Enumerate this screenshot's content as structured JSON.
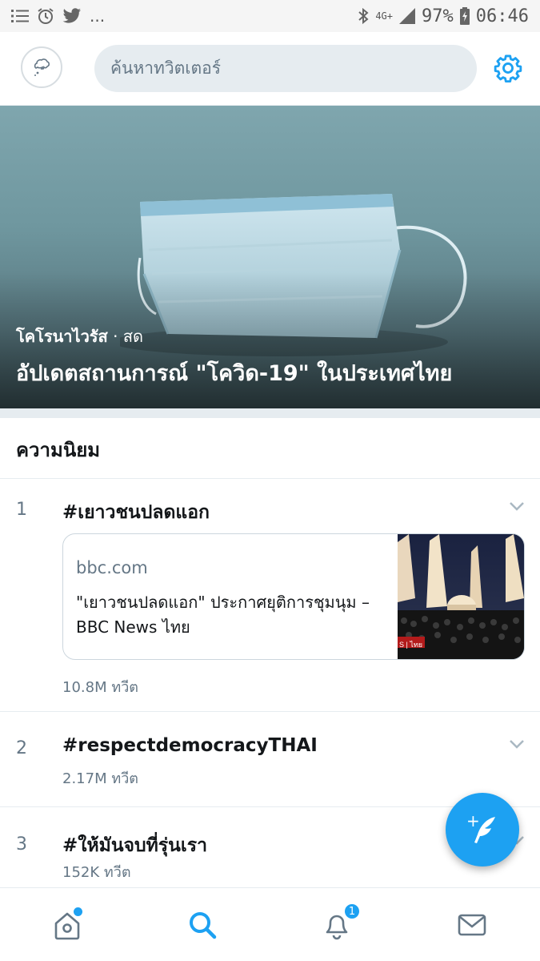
{
  "status_bar": {
    "time": "06:46",
    "battery": "97%",
    "network": "4G+",
    "more": "...",
    "icons": [
      "list-icon",
      "alarm-icon",
      "twitter-icon",
      "bluetooth-icon",
      "signal-icon",
      "battery-charging-icon"
    ]
  },
  "header": {
    "search_placeholder": "ค้นหาทวิตเตอร์",
    "avatar_icon": "avatar-icon",
    "settings_icon": "gear-icon"
  },
  "hero": {
    "kicker": "โคโรนาไวรัส",
    "separator": " · ",
    "live_label": "สด",
    "title": "อัปเดตสถานการณ์ \"โควิด-19\" ในประเทศไทย"
  },
  "section": {
    "title": "ความนิยม"
  },
  "trends": [
    {
      "rank": "1",
      "tag": "#เยาวชนปลดแอก",
      "count": "10.8M ทวีต",
      "card": {
        "source": "bbc.com",
        "headline": "\"เยาวชนปลดแอก\" ประกาศยุติการชุมนุม – BBC News ไทย",
        "thumb_label": "S | ไทย"
      }
    },
    {
      "rank": "2",
      "tag": "#respectdemocracyTHAI",
      "count": "2.17M ทวีต"
    },
    {
      "rank": "3",
      "tag": "#ให้มันจบที่รุ่นเรา",
      "count": "152K ทวีต"
    }
  ],
  "fab": {
    "icon": "compose-tweet-icon",
    "plus": "+"
  },
  "bottom_nav": {
    "items": [
      "home-icon",
      "search-icon",
      "notifications-icon",
      "messages-icon"
    ],
    "notification_badge": "1"
  },
  "colors": {
    "accent": "#1da1f2",
    "secondary_text": "#657786",
    "divider": "#e6ecf0"
  }
}
